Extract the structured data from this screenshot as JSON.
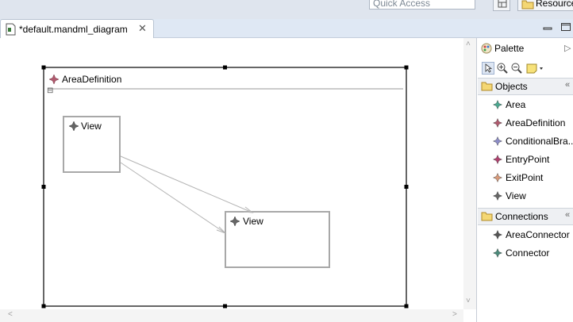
{
  "topbar": {
    "quick_access_placeholder": "Quick Access",
    "perspective_label": "Resource"
  },
  "editor": {
    "tab_label": "*default.mandml_diagram",
    "close_glyph": "✕"
  },
  "diagram": {
    "container_label": "AreaDefinition",
    "collapse_glyph": "⊟",
    "nodes": [
      {
        "label": "View"
      },
      {
        "label": "View"
      }
    ]
  },
  "palette": {
    "title": "Palette",
    "drawers": [
      {
        "label": "Objects",
        "items": [
          {
            "label": "Area",
            "color": "#4aa890"
          },
          {
            "label": "AreaDefinition",
            "color": "#b05a6e"
          },
          {
            "label": "ConditionalBra...",
            "color": "#8c8cc8"
          },
          {
            "label": "EntryPoint",
            "color": "#b0406e"
          },
          {
            "label": "ExitPoint",
            "color": "#d89a7a"
          },
          {
            "label": "View",
            "color": "#666666"
          }
        ]
      },
      {
        "label": "Connections",
        "items": [
          {
            "label": "AreaConnector",
            "color": "#555555"
          },
          {
            "label": "Connector",
            "color": "#4a8a7a"
          }
        ]
      }
    ]
  },
  "scroll": {
    "up": "˄",
    "down": "˅",
    "left": "˂",
    "right": "˃"
  },
  "colors": {
    "accent_folder": "#e8c24a",
    "selection_handle": "#000000"
  }
}
